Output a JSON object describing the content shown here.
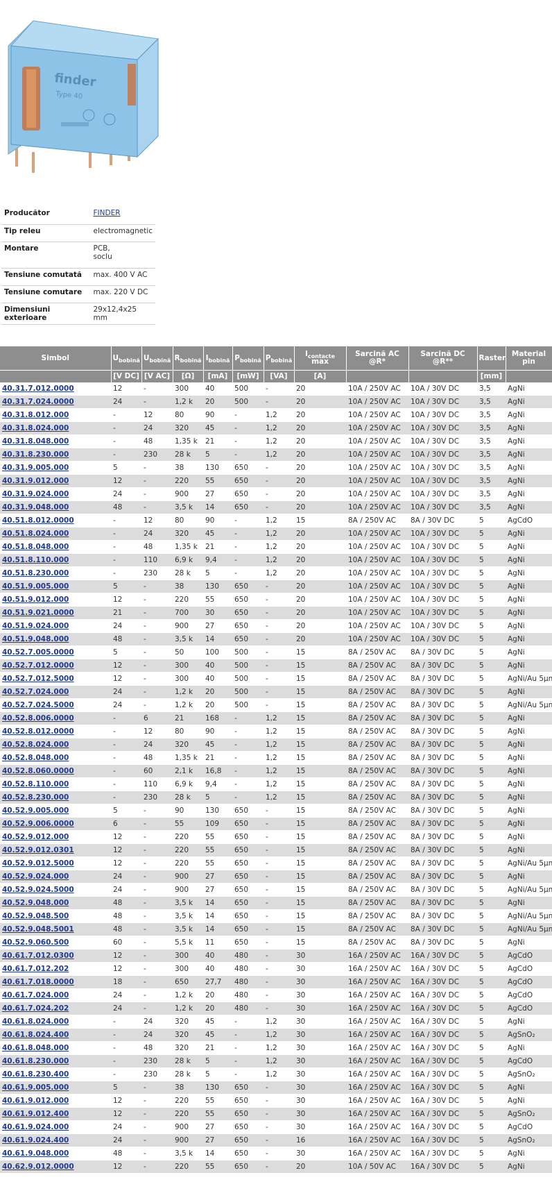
{
  "product": {
    "image_alt": "relay-photo",
    "brand_text": "finder",
    "model_text": "Type 40"
  },
  "specs": [
    {
      "label": "Producător",
      "value": "FINDER",
      "link": true
    },
    {
      "label": "Tip releu",
      "value": "electromagnetic"
    },
    {
      "label": "Montare",
      "value": "PCB,",
      "value2": "soclu"
    },
    {
      "label": "Tensiune comutată",
      "value": "max. 400 V AC"
    },
    {
      "label": "Tensiune comutare",
      "value": "max. 220 V DC"
    },
    {
      "label": "Dimensiuni exterioare",
      "value": "29x12,4x25 mm"
    }
  ],
  "table": {
    "headers": [
      {
        "main": "Simbol",
        "sub": "",
        "unit": ""
      },
      {
        "main": "U",
        "sub": "bobină",
        "unit": "[V DC]"
      },
      {
        "main": "U",
        "sub": "bobină",
        "unit": "[V AC]"
      },
      {
        "main": "R",
        "sub": "bobină",
        "unit": "[Ω]"
      },
      {
        "main": "I",
        "sub": "bobină",
        "unit": "[mA]"
      },
      {
        "main": "P",
        "sub": "bobină",
        "unit": "[mW]"
      },
      {
        "main": "P",
        "sub": "bobină",
        "unit": "[VA]"
      },
      {
        "main": "I",
        "sub": "contacte",
        "main2": "max",
        "unit": "[A]"
      },
      {
        "main": "Sarcină AC",
        "main2": "@R*",
        "sub": "",
        "unit": ""
      },
      {
        "main": "Sarcină DC",
        "main2": "@R**",
        "sub": "",
        "unit": ""
      },
      {
        "main": "Raster",
        "sub": "",
        "unit": "[mm]"
      },
      {
        "main": "Material",
        "main2": "pin",
        "sub": "",
        "unit": ""
      }
    ],
    "rows": [
      [
        "40.31.7.012.0000",
        "12",
        "-",
        "300",
        "40",
        "500",
        "-",
        "20",
        "10A / 250V AC",
        "10A / 30V DC",
        "3,5",
        "AgNi"
      ],
      [
        "40.31.7.024.0000",
        "24",
        "-",
        "1,2 k",
        "20",
        "500",
        "-",
        "20",
        "10A / 250V AC",
        "10A / 30V DC",
        "3,5",
        "AgNi"
      ],
      [
        "40.31.8.012.000",
        "-",
        "12",
        "80",
        "90",
        "-",
        "1,2",
        "20",
        "10A / 250V AC",
        "10A / 30V DC",
        "3,5",
        "AgNi"
      ],
      [
        "40.31.8.024.000",
        "-",
        "24",
        "320",
        "45",
        "-",
        "1,2",
        "20",
        "10A / 250V AC",
        "10A / 30V DC",
        "3,5",
        "AgNi"
      ],
      [
        "40.31.8.048.000",
        "-",
        "48",
        "1,35 k",
        "21",
        "-",
        "1,2",
        "20",
        "10A / 250V AC",
        "10A / 30V DC",
        "3,5",
        "AgNi"
      ],
      [
        "40.31.8.230.000",
        "-",
        "230",
        "28 k",
        "5",
        "-",
        "1,2",
        "20",
        "10A / 250V AC",
        "10A / 30V DC",
        "3,5",
        "AgNi"
      ],
      [
        "40.31.9.005.000",
        "5",
        "-",
        "38",
        "130",
        "650",
        "-",
        "20",
        "10A / 250V AC",
        "10A / 30V DC",
        "3,5",
        "AgNi"
      ],
      [
        "40.31.9.012.000",
        "12",
        "-",
        "220",
        "55",
        "650",
        "-",
        "20",
        "10A / 250V AC",
        "10A / 30V DC",
        "3,5",
        "AgNi"
      ],
      [
        "40.31.9.024.000",
        "24",
        "-",
        "900",
        "27",
        "650",
        "-",
        "20",
        "10A / 250V AC",
        "10A / 30V DC",
        "3,5",
        "AgNi"
      ],
      [
        "40.31.9.048.000",
        "48",
        "-",
        "3,5 k",
        "14",
        "650",
        "-",
        "20",
        "10A / 250V AC",
        "10A / 30V DC",
        "3,5",
        "AgNi"
      ],
      [
        "40.51.8.012.0000",
        "-",
        "12",
        "80",
        "90",
        "-",
        "1,2",
        "15",
        "8A / 250V AC",
        "8A / 30V DC",
        "5",
        "AgCdO"
      ],
      [
        "40.51.8.024.000",
        "-",
        "24",
        "320",
        "45",
        "-",
        "1,2",
        "20",
        "10A / 250V AC",
        "10A / 30V DC",
        "5",
        "AgNi"
      ],
      [
        "40.51.8.048.000",
        "-",
        "48",
        "1,35 k",
        "21",
        "-",
        "1,2",
        "20",
        "10A / 250V AC",
        "10A / 30V DC",
        "5",
        "AgNi"
      ],
      [
        "40.51.8.110.000",
        "-",
        "110",
        "6,9 k",
        "9,4",
        "-",
        "1,2",
        "20",
        "10A / 250V AC",
        "10A / 30V DC",
        "5",
        "AgNi"
      ],
      [
        "40.51.8.230.000",
        "-",
        "230",
        "28 k",
        "5",
        "-",
        "1,2",
        "20",
        "10A / 250V AC",
        "10A / 30V DC",
        "5",
        "AgNi"
      ],
      [
        "40.51.9.005.000",
        "5",
        "-",
        "38",
        "130",
        "650",
        "-",
        "20",
        "10A / 250V AC",
        "10A / 30V DC",
        "5",
        "AgNi"
      ],
      [
        "40.51.9.012.000",
        "12",
        "-",
        "220",
        "55",
        "650",
        "-",
        "20",
        "10A / 250V AC",
        "10A / 30V DC",
        "5",
        "AgNi"
      ],
      [
        "40.51.9.021.0000",
        "21",
        "-",
        "700",
        "30",
        "650",
        "-",
        "20",
        "10A / 250V AC",
        "10A / 30V DC",
        "5",
        "AgNi"
      ],
      [
        "40.51.9.024.000",
        "24",
        "-",
        "900",
        "27",
        "650",
        "-",
        "20",
        "10A / 250V AC",
        "10A / 30V DC",
        "5",
        "AgNi"
      ],
      [
        "40.51.9.048.000",
        "48",
        "-",
        "3,5 k",
        "14",
        "650",
        "-",
        "20",
        "10A / 250V AC",
        "10A / 30V DC",
        "5",
        "AgNi"
      ],
      [
        "40.52.7.005.0000",
        "5",
        "-",
        "50",
        "100",
        "500",
        "-",
        "15",
        "8A / 250V AC",
        "8A / 30V DC",
        "5",
        "AgNi"
      ],
      [
        "40.52.7.012.0000",
        "12",
        "-",
        "300",
        "40",
        "500",
        "-",
        "15",
        "8A / 250V AC",
        "8A / 30V DC",
        "5",
        "AgNi"
      ],
      [
        "40.52.7.012.5000",
        "12",
        "-",
        "300",
        "40",
        "500",
        "-",
        "15",
        "8A / 250V AC",
        "8A / 30V DC",
        "5",
        "AgNi/Au 5µm"
      ],
      [
        "40.52.7.024.000",
        "24",
        "-",
        "1,2 k",
        "20",
        "500",
        "-",
        "15",
        "8A / 250V AC",
        "8A / 30V DC",
        "5",
        "AgNi"
      ],
      [
        "40.52.7.024.5000",
        "24",
        "-",
        "1,2 k",
        "20",
        "500",
        "-",
        "15",
        "8A / 250V AC",
        "8A / 30V DC",
        "5",
        "AgNi/Au 5µm"
      ],
      [
        "40.52.8.006.0000",
        "-",
        "6",
        "21",
        "168",
        "-",
        "1,2",
        "15",
        "8A / 250V AC",
        "8A / 30V DC",
        "5",
        "AgNi"
      ],
      [
        "40.52.8.012.0000",
        "-",
        "12",
        "80",
        "90",
        "-",
        "1,2",
        "15",
        "8A / 250V AC",
        "8A / 30V DC",
        "5",
        "AgNi"
      ],
      [
        "40.52.8.024.000",
        "-",
        "24",
        "320",
        "45",
        "-",
        "1,2",
        "15",
        "8A / 250V AC",
        "8A / 30V DC",
        "5",
        "AgNi"
      ],
      [
        "40.52.8.048.000",
        "-",
        "48",
        "1,35 k",
        "21",
        "-",
        "1,2",
        "15",
        "8A / 250V AC",
        "8A / 30V DC",
        "5",
        "AgNi"
      ],
      [
        "40.52.8.060.0000",
        "-",
        "60",
        "2,1 k",
        "16,8",
        "-",
        "1,2",
        "15",
        "8A / 250V AC",
        "8A / 30V DC",
        "5",
        "AgNi"
      ],
      [
        "40.52.8.110.000",
        "-",
        "110",
        "6,9 k",
        "9,4",
        "-",
        "1,2",
        "15",
        "8A / 250V AC",
        "8A / 30V DC",
        "5",
        "AgNi"
      ],
      [
        "40.52.8.230.000",
        "-",
        "230",
        "28 k",
        "5",
        "-",
        "1,2",
        "15",
        "8A / 250V AC",
        "8A / 30V DC",
        "5",
        "AgNi"
      ],
      [
        "40.52.9.005.000",
        "5",
        "-",
        "90",
        "130",
        "650",
        "-",
        "15",
        "8A / 250V AC",
        "8A / 30V DC",
        "5",
        "AgNi"
      ],
      [
        "40.52.9.006.0000",
        "6",
        "-",
        "55",
        "109",
        "650",
        "-",
        "15",
        "8A / 250V AC",
        "8A / 30V DC",
        "5",
        "AgNi"
      ],
      [
        "40.52.9.012.000",
        "12",
        "-",
        "220",
        "55",
        "650",
        "-",
        "15",
        "8A / 250V AC",
        "8A / 30V DC",
        "5",
        "AgNi"
      ],
      [
        "40.52.9.012.0301",
        "12",
        "-",
        "220",
        "55",
        "650",
        "-",
        "15",
        "8A / 250V AC",
        "8A / 30V DC",
        "5",
        "AgNi"
      ],
      [
        "40.52.9.012.5000",
        "12",
        "-",
        "220",
        "55",
        "650",
        "-",
        "15",
        "8A / 250V AC",
        "8A / 30V DC",
        "5",
        "AgNi/Au 5µm"
      ],
      [
        "40.52.9.024.000",
        "24",
        "-",
        "900",
        "27",
        "650",
        "-",
        "15",
        "8A / 250V AC",
        "8A / 30V DC",
        "5",
        "AgNi"
      ],
      [
        "40.52.9.024.5000",
        "24",
        "-",
        "900",
        "27",
        "650",
        "-",
        "15",
        "8A / 250V AC",
        "8A / 30V DC",
        "5",
        "AgNi/Au 5µm"
      ],
      [
        "40.52.9.048.000",
        "48",
        "-",
        "3,5 k",
        "14",
        "650",
        "-",
        "15",
        "8A / 250V AC",
        "8A / 30V DC",
        "5",
        "AgNi"
      ],
      [
        "40.52.9.048.500",
        "48",
        "-",
        "3,5 k",
        "14",
        "650",
        "-",
        "15",
        "8A / 250V AC",
        "8A / 30V DC",
        "5",
        "AgNi/Au 5µm"
      ],
      [
        "40.52.9.048.5001",
        "48",
        "-",
        "3,5 k",
        "14",
        "650",
        "-",
        "15",
        "8A / 250V AC",
        "8A / 30V DC",
        "5",
        "AgNi/Au 5µm"
      ],
      [
        "40.52.9.060.500",
        "60",
        "-",
        "5,5 k",
        "11",
        "650",
        "-",
        "15",
        "8A / 250V AC",
        "8A / 30V DC",
        "5",
        "AgNi"
      ],
      [
        "40.61.7.012.0300",
        "12",
        "-",
        "300",
        "40",
        "480",
        "-",
        "30",
        "16A / 250V AC",
        "16A / 30V DC",
        "5",
        "AgCdO"
      ],
      [
        "40.61.7.012.202",
        "12",
        "-",
        "300",
        "40",
        "480",
        "-",
        "30",
        "16A / 250V AC",
        "16A / 30V DC",
        "5",
        "AgCdO"
      ],
      [
        "40.61.7.018.0000",
        "18",
        "-",
        "650",
        "27,7",
        "480",
        "-",
        "30",
        "16A / 250V AC",
        "16A / 30V DC",
        "5",
        "AgCdO"
      ],
      [
        "40.61.7.024.000",
        "24",
        "-",
        "1,2 k",
        "20",
        "480",
        "-",
        "30",
        "16A / 250V AC",
        "16A / 30V DC",
        "5",
        "AgCdO"
      ],
      [
        "40.61.7.024.202",
        "24",
        "-",
        "1,2 k",
        "20",
        "480",
        "-",
        "30",
        "16A / 250V AC",
        "16A / 30V DC",
        "5",
        "AgCdO"
      ],
      [
        "40.61.8.024.000",
        "-",
        "24",
        "320",
        "45",
        "-",
        "1,2",
        "30",
        "16A / 250V AC",
        "16A / 30V DC",
        "5",
        "AgNi"
      ],
      [
        "40.61.8.024.400",
        "-",
        "24",
        "320",
        "45",
        "-",
        "1,2",
        "30",
        "16A / 250V AC",
        "16A / 30V DC",
        "5",
        "AgSnO₂"
      ],
      [
        "40.61.8.048.000",
        "-",
        "48",
        "320",
        "21",
        "-",
        "1,2",
        "30",
        "16A / 250V AC",
        "16A / 30V DC",
        "5",
        "AgNi"
      ],
      [
        "40.61.8.230.000",
        "-",
        "230",
        "28 k",
        "5",
        "-",
        "1,2",
        "30",
        "16A / 250V AC",
        "16A / 30V DC",
        "5",
        "AgCdO"
      ],
      [
        "40.61.8.230.400",
        "-",
        "230",
        "28 k",
        "5",
        "-",
        "1,2",
        "30",
        "16A / 250V AC",
        "16A / 30V DC",
        "5",
        "AgSnO₂"
      ],
      [
        "40.61.9.005.000",
        "5",
        "-",
        "38",
        "130",
        "650",
        "-",
        "30",
        "16A / 250V AC",
        "16A / 30V DC",
        "5",
        "AgNi"
      ],
      [
        "40.61.9.012.000",
        "12",
        "-",
        "220",
        "55",
        "650",
        "-",
        "30",
        "16A / 250V AC",
        "16A / 30V DC",
        "5",
        "AgNi"
      ],
      [
        "40.61.9.012.400",
        "12",
        "-",
        "220",
        "55",
        "650",
        "-",
        "30",
        "16A / 250V AC",
        "16A / 30V DC",
        "5",
        "AgSnO₂"
      ],
      [
        "40.61.9.024.000",
        "24",
        "-",
        "900",
        "27",
        "650",
        "-",
        "30",
        "16A / 250V AC",
        "16A / 30V DC",
        "5",
        "AgCdO"
      ],
      [
        "40.61.9.024.400",
        "24",
        "-",
        "900",
        "27",
        "650",
        "-",
        "16",
        "16A / 250V AC",
        "16A / 30V DC",
        "5",
        "AgSnO₂"
      ],
      [
        "40.61.9.048.000",
        "48",
        "-",
        "3,5 k",
        "14",
        "650",
        "-",
        "30",
        "16A / 250V AC",
        "16A / 30V DC",
        "5",
        "AgNi"
      ],
      [
        "40.62.9.012.0000",
        "12",
        "-",
        "220",
        "55",
        "650",
        "-",
        "20",
        "10A / 50V AC",
        "16A / 30V DC",
        "5",
        "AgNi"
      ]
    ]
  }
}
